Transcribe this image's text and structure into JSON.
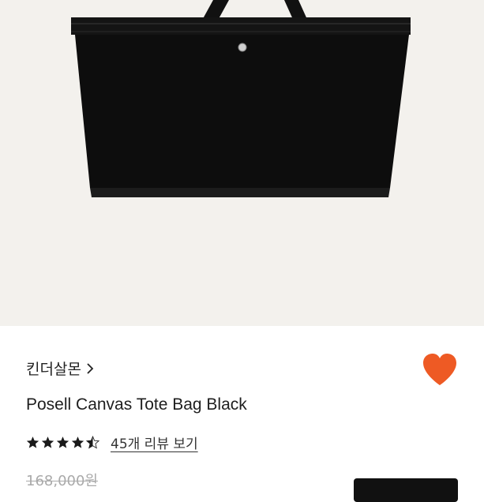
{
  "product": {
    "brand": "킨더살몬",
    "name": "Posell Canvas Tote Bag Black",
    "rating": 4.5,
    "review_link": "45개 리뷰 보기",
    "original_price": "168,000원"
  },
  "icons": {
    "favorite": "heart-icon",
    "brand_link": "chevron-right-icon",
    "rating": "star-icon"
  },
  "colors": {
    "hero_background": "#f3f1ed",
    "heart": "#ee5a24",
    "bag": "#0d0d0d",
    "stars": "#1a1a1a"
  }
}
